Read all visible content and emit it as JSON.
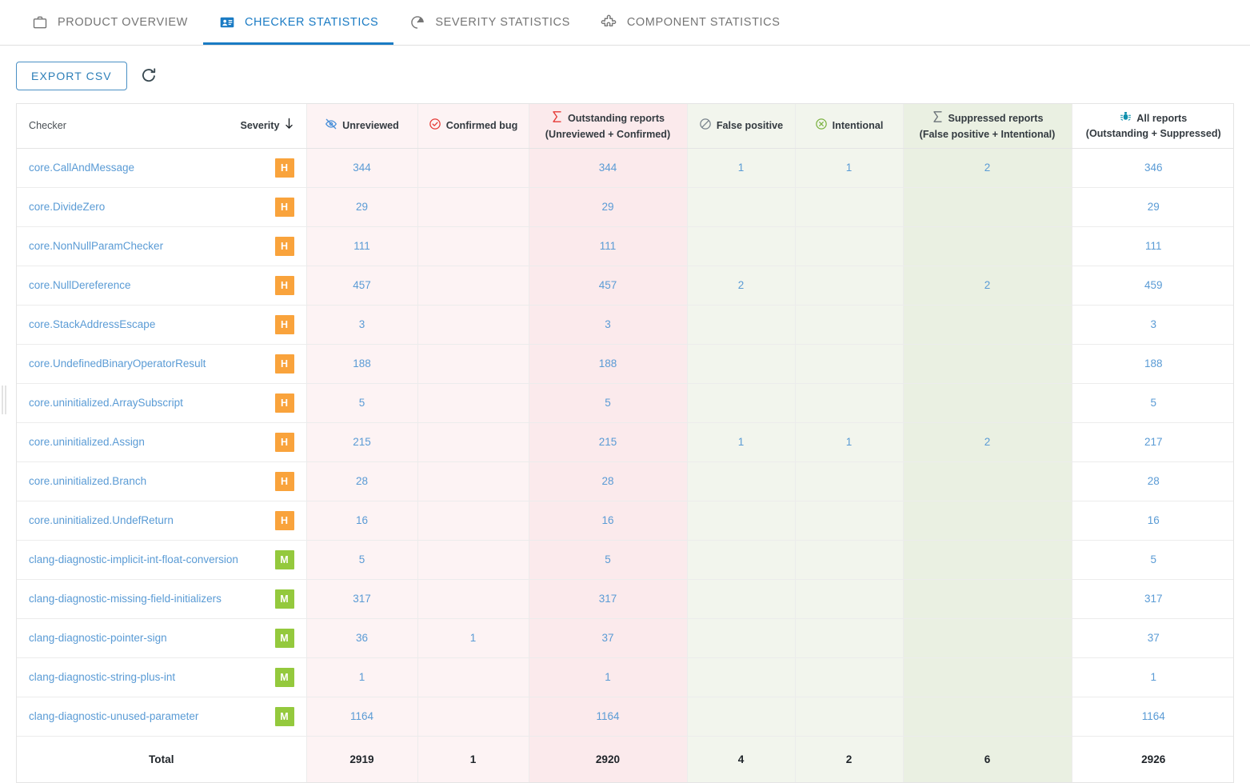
{
  "tabs": [
    {
      "label": "PRODUCT OVERVIEW",
      "icon": "briefcase-icon",
      "active": false
    },
    {
      "label": "CHECKER STATISTICS",
      "icon": "id-card-icon",
      "active": true
    },
    {
      "label": "SEVERITY STATISTICS",
      "icon": "gauge-icon",
      "active": false
    },
    {
      "label": "COMPONENT STATISTICS",
      "icon": "puzzle-piece-icon",
      "active": false
    }
  ],
  "toolbar": {
    "export_label": "EXPORT CSV",
    "refresh_icon": "refresh-icon"
  },
  "table": {
    "columns": {
      "checker": "Checker",
      "severity": "Severity",
      "severity_sort_icon": "sort-descending-arrow-icon",
      "unreviewed": "Unreviewed",
      "unreviewed_icon": "eye-slash-icon",
      "confirmed": "Confirmed bug",
      "confirmed_icon": "check-circle-icon",
      "outstanding": "Outstanding reports",
      "outstanding_sub": "(Unreviewed + Confirmed)",
      "outstanding_icon": "sigma-icon",
      "false_positive": "False positive",
      "false_positive_icon": "no-entry-circle-icon",
      "intentional": "Intentional",
      "intentional_icon": "x-circle-icon",
      "suppressed": "Suppressed reports",
      "suppressed_sub": "(False positive + Intentional)",
      "suppressed_icon": "sigma-icon",
      "all_reports": "All reports",
      "all_reports_sub": "(Outstanding + Suppressed)",
      "all_reports_icon": "bug-icon"
    },
    "rows": [
      {
        "checker": "core.CallAndMessage",
        "severity": "H",
        "unreviewed": "344",
        "confirmed": "",
        "outstanding": "344",
        "false_positive": "1",
        "intentional": "1",
        "suppressed": "2",
        "all_reports": "346"
      },
      {
        "checker": "core.DivideZero",
        "severity": "H",
        "unreviewed": "29",
        "confirmed": "",
        "outstanding": "29",
        "false_positive": "",
        "intentional": "",
        "suppressed": "",
        "all_reports": "29"
      },
      {
        "checker": "core.NonNullParamChecker",
        "severity": "H",
        "unreviewed": "111",
        "confirmed": "",
        "outstanding": "111",
        "false_positive": "",
        "intentional": "",
        "suppressed": "",
        "all_reports": "111"
      },
      {
        "checker": "core.NullDereference",
        "severity": "H",
        "unreviewed": "457",
        "confirmed": "",
        "outstanding": "457",
        "false_positive": "2",
        "intentional": "",
        "suppressed": "2",
        "all_reports": "459"
      },
      {
        "checker": "core.StackAddressEscape",
        "severity": "H",
        "unreviewed": "3",
        "confirmed": "",
        "outstanding": "3",
        "false_positive": "",
        "intentional": "",
        "suppressed": "",
        "all_reports": "3"
      },
      {
        "checker": "core.UndefinedBinaryOperatorResult",
        "severity": "H",
        "unreviewed": "188",
        "confirmed": "",
        "outstanding": "188",
        "false_positive": "",
        "intentional": "",
        "suppressed": "",
        "all_reports": "188"
      },
      {
        "checker": "core.uninitialized.ArraySubscript",
        "severity": "H",
        "unreviewed": "5",
        "confirmed": "",
        "outstanding": "5",
        "false_positive": "",
        "intentional": "",
        "suppressed": "",
        "all_reports": "5"
      },
      {
        "checker": "core.uninitialized.Assign",
        "severity": "H",
        "unreviewed": "215",
        "confirmed": "",
        "outstanding": "215",
        "false_positive": "1",
        "intentional": "1",
        "suppressed": "2",
        "all_reports": "217"
      },
      {
        "checker": "core.uninitialized.Branch",
        "severity": "H",
        "unreviewed": "28",
        "confirmed": "",
        "outstanding": "28",
        "false_positive": "",
        "intentional": "",
        "suppressed": "",
        "all_reports": "28"
      },
      {
        "checker": "core.uninitialized.UndefReturn",
        "severity": "H",
        "unreviewed": "16",
        "confirmed": "",
        "outstanding": "16",
        "false_positive": "",
        "intentional": "",
        "suppressed": "",
        "all_reports": "16"
      },
      {
        "checker": "clang-diagnostic-implicit-int-float-conversion",
        "severity": "M",
        "unreviewed": "5",
        "confirmed": "",
        "outstanding": "5",
        "false_positive": "",
        "intentional": "",
        "suppressed": "",
        "all_reports": "5"
      },
      {
        "checker": "clang-diagnostic-missing-field-initializers",
        "severity": "M",
        "unreviewed": "317",
        "confirmed": "",
        "outstanding": "317",
        "false_positive": "",
        "intentional": "",
        "suppressed": "",
        "all_reports": "317"
      },
      {
        "checker": "clang-diagnostic-pointer-sign",
        "severity": "M",
        "unreviewed": "36",
        "confirmed": "1",
        "outstanding": "37",
        "false_positive": "",
        "intentional": "",
        "suppressed": "",
        "all_reports": "37"
      },
      {
        "checker": "clang-diagnostic-string-plus-int",
        "severity": "M",
        "unreviewed": "1",
        "confirmed": "",
        "outstanding": "1",
        "false_positive": "",
        "intentional": "",
        "suppressed": "",
        "all_reports": "1"
      },
      {
        "checker": "clang-diagnostic-unused-parameter",
        "severity": "M",
        "unreviewed": "1164",
        "confirmed": "",
        "outstanding": "1164",
        "false_positive": "",
        "intentional": "",
        "suppressed": "",
        "all_reports": "1164"
      }
    ],
    "total": {
      "label": "Total",
      "unreviewed": "2919",
      "confirmed": "1",
      "outstanding": "2920",
      "false_positive": "4",
      "intentional": "2",
      "suppressed": "6",
      "all_reports": "2926"
    }
  },
  "colors": {
    "accent": "#1a7bc4",
    "link": "#5a9bd5",
    "severity_high": "#f9a33c",
    "severity_medium": "#94c93d",
    "outstanding_tint": "#fbeaec",
    "unreviewed_tint": "#fdf3f4",
    "suppressed_tint": "#eaf0e2",
    "false_positive_tint": "#f2f5ed",
    "sigma_red": "#e53935",
    "sigma_gray": "#6b7278",
    "bug_teal": "#0f90ad"
  }
}
